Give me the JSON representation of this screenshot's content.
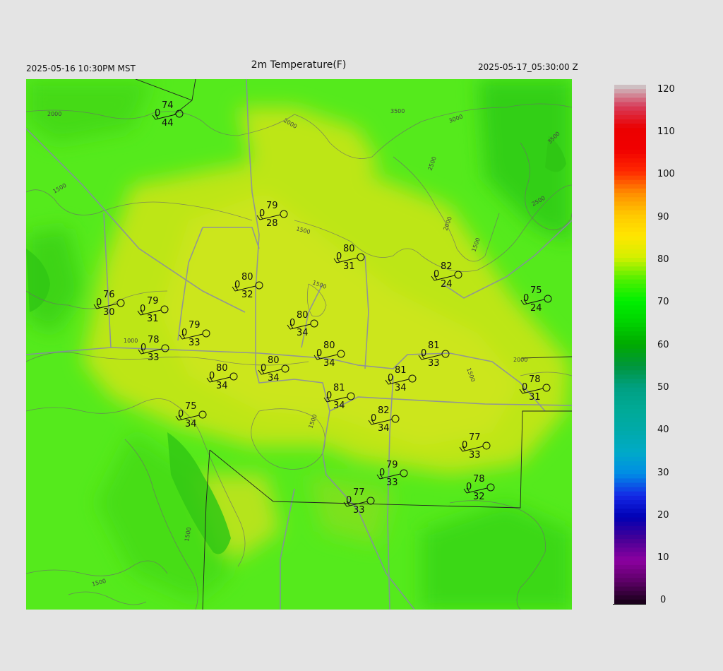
{
  "header": {
    "title": "2m Temperature(F)",
    "local_time": "2025-05-16 10:30PM MST",
    "utc_time": "2025-05-17_05:30:00 Z"
  },
  "colorbar": {
    "ticks": [
      "120",
      "110",
      "100",
      "90",
      "80",
      "70",
      "60",
      "50",
      "40",
      "30",
      "20",
      "10",
      "0"
    ],
    "range": [
      0,
      120
    ]
  },
  "contour_labels": [
    "2000",
    "2000",
    "3500",
    "3000",
    "3500",
    "2500",
    "2500",
    "2000",
    "1500",
    "1500",
    "1500",
    "1500",
    "2000",
    "1000",
    "1500",
    "1500",
    "1500",
    "1500"
  ],
  "stations": [
    {
      "temp": "74",
      "dew": "44",
      "cld": "0"
    },
    {
      "temp": "79",
      "dew": "28",
      "cld": "0"
    },
    {
      "temp": "80",
      "dew": "31",
      "cld": "0"
    },
    {
      "temp": "82",
      "dew": "24",
      "cld": "0"
    },
    {
      "temp": "80",
      "dew": "32",
      "cld": "0"
    },
    {
      "temp": "76",
      "dew": "30",
      "cld": "0"
    },
    {
      "temp": "79",
      "dew": "31",
      "cld": "0"
    },
    {
      "temp": "75",
      "dew": "24",
      "cld": "0"
    },
    {
      "temp": "80",
      "dew": "34",
      "cld": "0"
    },
    {
      "temp": "79",
      "dew": "33",
      "cld": "0"
    },
    {
      "temp": "78",
      "dew": "33",
      "cld": "0"
    },
    {
      "temp": "80",
      "dew": "34",
      "cld": "0"
    },
    {
      "temp": "81",
      "dew": "33",
      "cld": "0"
    },
    {
      "temp": "80",
      "dew": "34",
      "cld": "0"
    },
    {
      "temp": "80",
      "dew": "34",
      "cld": "0"
    },
    {
      "temp": "81",
      "dew": "34",
      "cld": "0"
    },
    {
      "temp": "78",
      "dew": "31",
      "cld": "0"
    },
    {
      "temp": "81",
      "dew": "34",
      "cld": "0"
    },
    {
      "temp": "75",
      "dew": "34",
      "cld": "0"
    },
    {
      "temp": "82",
      "dew": "34",
      "cld": "0"
    },
    {
      "temp": "77",
      "dew": "33",
      "cld": "0"
    },
    {
      "temp": "79",
      "dew": "33",
      "cld": "0"
    },
    {
      "temp": "78",
      "dew": "32",
      "cld": "0"
    },
    {
      "temp": "77",
      "dew": "33",
      "cld": "0"
    }
  ]
}
